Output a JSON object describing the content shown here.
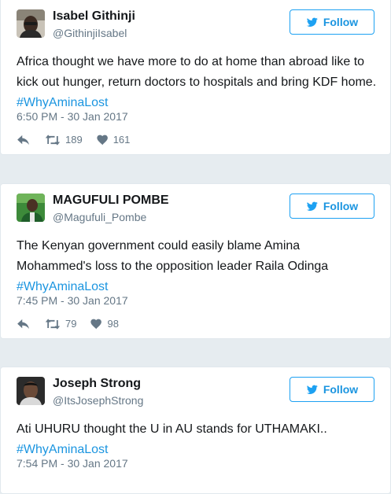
{
  "tweets": [
    {
      "name": "Isabel Githinji",
      "handle": "@GithinjiIsabel",
      "follow_label": "Follow",
      "text_lines": [
        "Africa thought we have more to do at home than abroad like to",
        "kick out hunger, return doctors to hospitals and bring KDF home."
      ],
      "hashtag": "#WhyAminaLost",
      "time": "6:50 PM - 30 Jan 2017",
      "retweets": "189",
      "likes": "161"
    },
    {
      "name": "MAGUFULI POMBE",
      "handle": "@Magufuli_Pombe",
      "follow_label": "Follow",
      "text_lines": [
        "The Kenyan government could easily blame Amina",
        "Mohammed's loss to the opposition leader Raila Odinga"
      ],
      "hashtag": "#WhyAminaLost",
      "time": "7:45 PM - 30 Jan 2017",
      "retweets": "79",
      "likes": "98"
    },
    {
      "name": "Joseph Strong",
      "handle": "@ItsJosephStrong",
      "follow_label": "Follow",
      "text_lines": [
        "Ati UHURU thought the U in AU stands for UTHAMAKI.."
      ],
      "hashtag": "#WhyAminaLost",
      "time": "7:54 PM - 30 Jan 2017"
    }
  ],
  "icons": {
    "follow": "twitter-bird-icon",
    "reply": "reply-icon",
    "retweet": "retweet-icon",
    "like": "heart-icon"
  },
  "colors": {
    "accent": "#1da1f2",
    "link": "#1b95e0",
    "muted": "#657786",
    "background": "#e6ecf0"
  }
}
